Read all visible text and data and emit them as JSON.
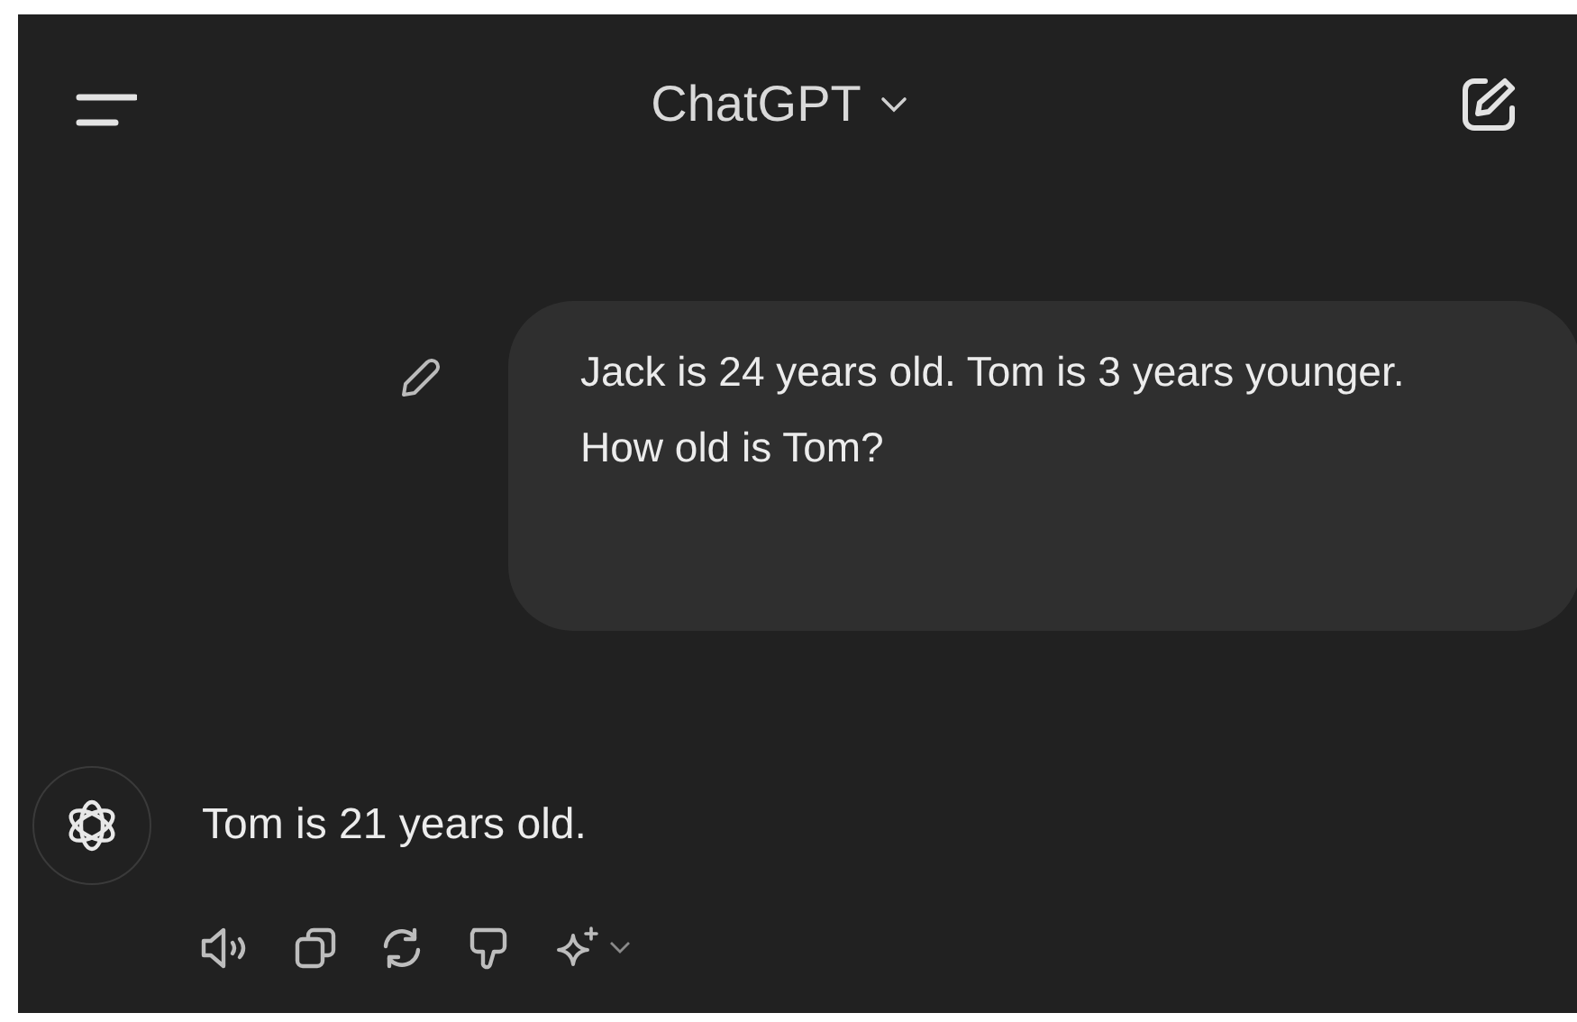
{
  "header": {
    "title": "ChatGPT"
  },
  "user_message": {
    "paragraphs": [
      "Jack is 24 years old. Tom is 3 years younger.",
      "How old is Tom?"
    ]
  },
  "assistant_message": {
    "text": "Tom is 21 years old."
  }
}
